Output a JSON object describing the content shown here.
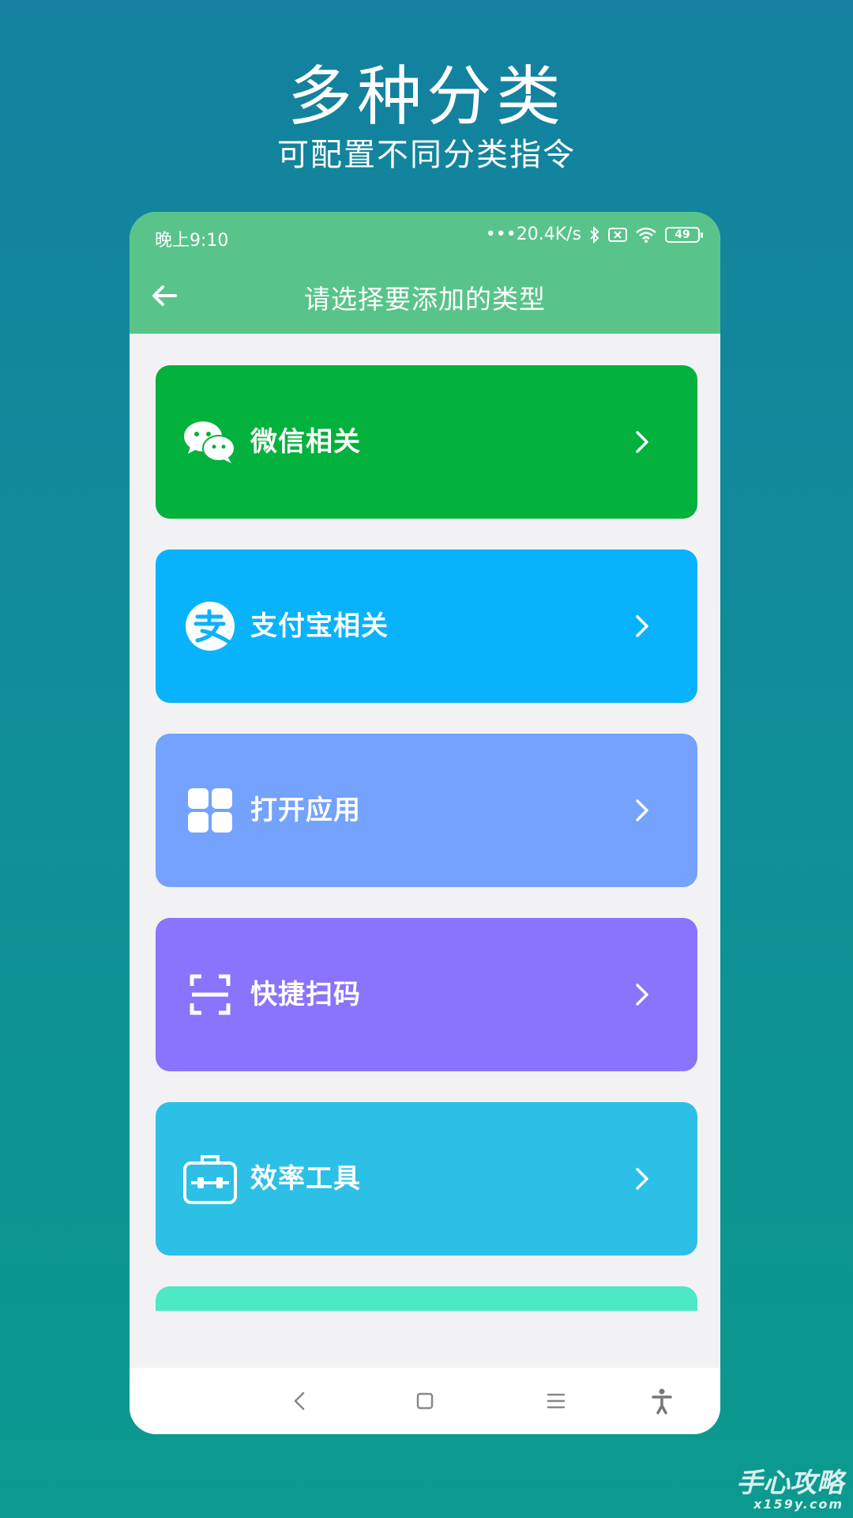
{
  "promo": {
    "title": "多种分类",
    "subtitle": "可配置不同分类指令"
  },
  "status_bar": {
    "time": "晚上9:10",
    "network_speed": "20.4K/s",
    "battery": "49"
  },
  "appbar": {
    "title": "请选择要添加的类型",
    "back_icon": "arrow-left-icon"
  },
  "categories": [
    {
      "label": "微信相关",
      "icon": "wechat-icon",
      "color": "#03b13d"
    },
    {
      "label": "支付宝相关",
      "icon": "alipay-icon",
      "color": "#08b3fb"
    },
    {
      "label": "打开应用",
      "icon": "grid-apps-icon",
      "color": "#74a2fd"
    },
    {
      "label": "快捷扫码",
      "icon": "scan-icon",
      "color": "#8a73fd"
    },
    {
      "label": "效率工具",
      "icon": "toolbox-icon",
      "color": "#2cc0e7"
    },
    {
      "label": "",
      "icon": "",
      "color": "#4de8c5"
    }
  ],
  "navbar": {
    "icons": [
      "back-icon",
      "home-icon",
      "menu-icon",
      "accessibility-icon"
    ]
  },
  "watermark": {
    "text": "手心攻略",
    "sub": "x159y.com"
  }
}
